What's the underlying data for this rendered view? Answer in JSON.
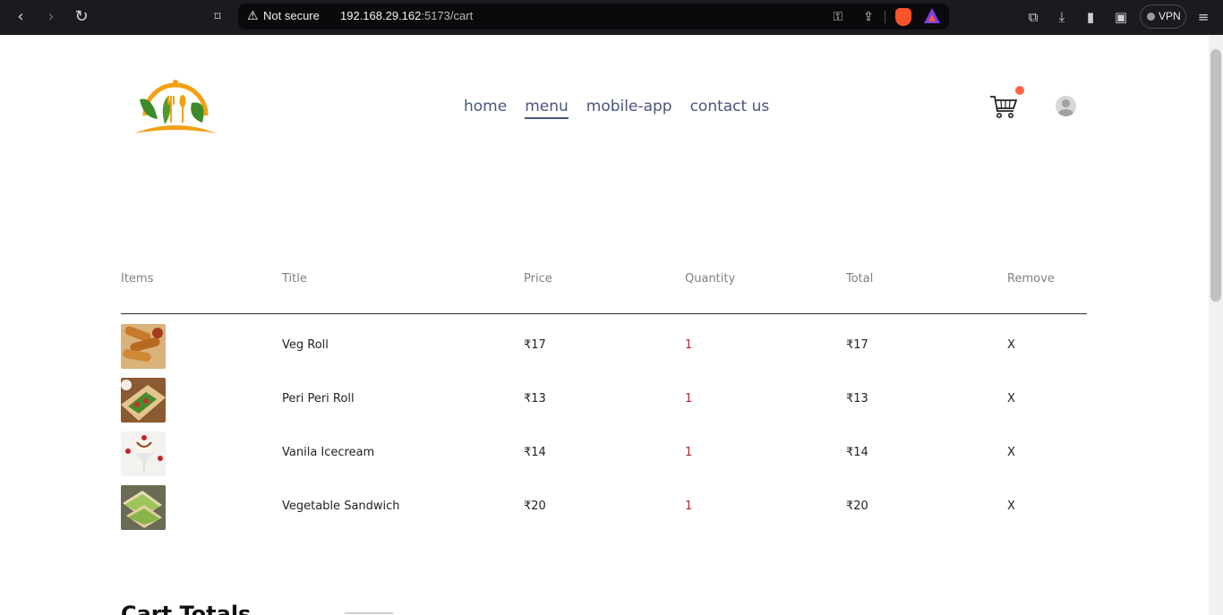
{
  "browser": {
    "security_label": "Not secure",
    "url_host": "192.168.29.162",
    "url_path": ":5173/cart",
    "vpn_label": "VPN"
  },
  "navbar": {
    "links": [
      "home",
      "menu",
      "mobile-app",
      "contact us"
    ],
    "active_link": "menu"
  },
  "cart": {
    "headers": [
      "Items",
      "Title",
      "Price",
      "Quantity",
      "Total",
      "Remove"
    ],
    "items": [
      {
        "title": "Veg Roll",
        "price": "₹17",
        "quantity": "1",
        "total": "₹17",
        "remove": "X",
        "image": "veg-roll"
      },
      {
        "title": "Peri Peri Roll",
        "price": "₹13",
        "quantity": "1",
        "total": "₹13",
        "remove": "X",
        "image": "peri-peri-roll"
      },
      {
        "title": "Vanila Icecream",
        "price": "₹14",
        "quantity": "1",
        "total": "₹14",
        "remove": "X",
        "image": "vanila-icecream"
      },
      {
        "title": "Vegetable Sandwich",
        "price": "₹20",
        "quantity": "1",
        "total": "₹20",
        "remove": "X",
        "image": "vegetable-sandwich"
      }
    ]
  },
  "totals": {
    "title": "Cart Totals"
  },
  "colors": {
    "nav_text": "#49557e",
    "cart_dot": "#ff6347",
    "logo_orange": "#f4a011",
    "logo_green": "#3c8a2a"
  }
}
